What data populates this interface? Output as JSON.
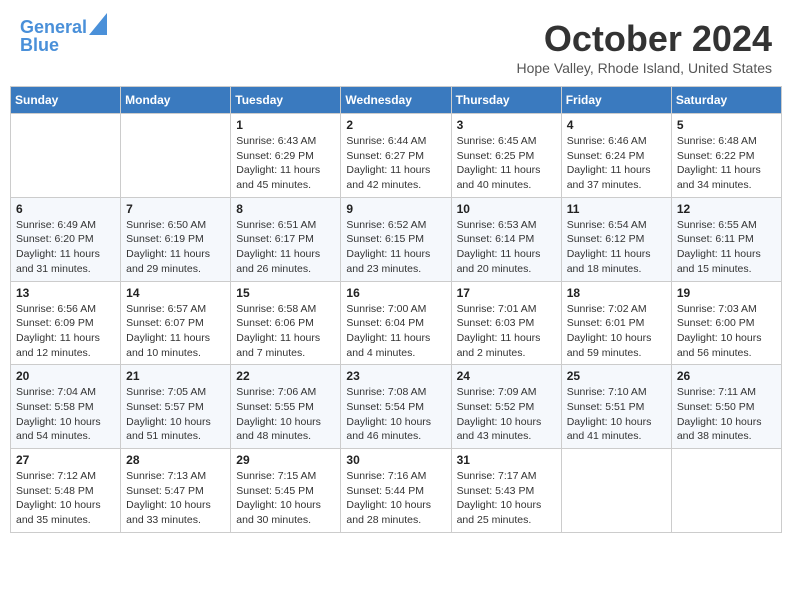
{
  "logo": {
    "line1": "General",
    "line2": "Blue"
  },
  "title": "October 2024",
  "subtitle": "Hope Valley, Rhode Island, United States",
  "weekdays": [
    "Sunday",
    "Monday",
    "Tuesday",
    "Wednesday",
    "Thursday",
    "Friday",
    "Saturday"
  ],
  "weeks": [
    [
      {
        "day": "",
        "sunrise": "",
        "sunset": "",
        "daylight": ""
      },
      {
        "day": "",
        "sunrise": "",
        "sunset": "",
        "daylight": ""
      },
      {
        "day": "1",
        "sunrise": "Sunrise: 6:43 AM",
        "sunset": "Sunset: 6:29 PM",
        "daylight": "Daylight: 11 hours and 45 minutes."
      },
      {
        "day": "2",
        "sunrise": "Sunrise: 6:44 AM",
        "sunset": "Sunset: 6:27 PM",
        "daylight": "Daylight: 11 hours and 42 minutes."
      },
      {
        "day": "3",
        "sunrise": "Sunrise: 6:45 AM",
        "sunset": "Sunset: 6:25 PM",
        "daylight": "Daylight: 11 hours and 40 minutes."
      },
      {
        "day": "4",
        "sunrise": "Sunrise: 6:46 AM",
        "sunset": "Sunset: 6:24 PM",
        "daylight": "Daylight: 11 hours and 37 minutes."
      },
      {
        "day": "5",
        "sunrise": "Sunrise: 6:48 AM",
        "sunset": "Sunset: 6:22 PM",
        "daylight": "Daylight: 11 hours and 34 minutes."
      }
    ],
    [
      {
        "day": "6",
        "sunrise": "Sunrise: 6:49 AM",
        "sunset": "Sunset: 6:20 PM",
        "daylight": "Daylight: 11 hours and 31 minutes."
      },
      {
        "day": "7",
        "sunrise": "Sunrise: 6:50 AM",
        "sunset": "Sunset: 6:19 PM",
        "daylight": "Daylight: 11 hours and 29 minutes."
      },
      {
        "day": "8",
        "sunrise": "Sunrise: 6:51 AM",
        "sunset": "Sunset: 6:17 PM",
        "daylight": "Daylight: 11 hours and 26 minutes."
      },
      {
        "day": "9",
        "sunrise": "Sunrise: 6:52 AM",
        "sunset": "Sunset: 6:15 PM",
        "daylight": "Daylight: 11 hours and 23 minutes."
      },
      {
        "day": "10",
        "sunrise": "Sunrise: 6:53 AM",
        "sunset": "Sunset: 6:14 PM",
        "daylight": "Daylight: 11 hours and 20 minutes."
      },
      {
        "day": "11",
        "sunrise": "Sunrise: 6:54 AM",
        "sunset": "Sunset: 6:12 PM",
        "daylight": "Daylight: 11 hours and 18 minutes."
      },
      {
        "day": "12",
        "sunrise": "Sunrise: 6:55 AM",
        "sunset": "Sunset: 6:11 PM",
        "daylight": "Daylight: 11 hours and 15 minutes."
      }
    ],
    [
      {
        "day": "13",
        "sunrise": "Sunrise: 6:56 AM",
        "sunset": "Sunset: 6:09 PM",
        "daylight": "Daylight: 11 hours and 12 minutes."
      },
      {
        "day": "14",
        "sunrise": "Sunrise: 6:57 AM",
        "sunset": "Sunset: 6:07 PM",
        "daylight": "Daylight: 11 hours and 10 minutes."
      },
      {
        "day": "15",
        "sunrise": "Sunrise: 6:58 AM",
        "sunset": "Sunset: 6:06 PM",
        "daylight": "Daylight: 11 hours and 7 minutes."
      },
      {
        "day": "16",
        "sunrise": "Sunrise: 7:00 AM",
        "sunset": "Sunset: 6:04 PM",
        "daylight": "Daylight: 11 hours and 4 minutes."
      },
      {
        "day": "17",
        "sunrise": "Sunrise: 7:01 AM",
        "sunset": "Sunset: 6:03 PM",
        "daylight": "Daylight: 11 hours and 2 minutes."
      },
      {
        "day": "18",
        "sunrise": "Sunrise: 7:02 AM",
        "sunset": "Sunset: 6:01 PM",
        "daylight": "Daylight: 10 hours and 59 minutes."
      },
      {
        "day": "19",
        "sunrise": "Sunrise: 7:03 AM",
        "sunset": "Sunset: 6:00 PM",
        "daylight": "Daylight: 10 hours and 56 minutes."
      }
    ],
    [
      {
        "day": "20",
        "sunrise": "Sunrise: 7:04 AM",
        "sunset": "Sunset: 5:58 PM",
        "daylight": "Daylight: 10 hours and 54 minutes."
      },
      {
        "day": "21",
        "sunrise": "Sunrise: 7:05 AM",
        "sunset": "Sunset: 5:57 PM",
        "daylight": "Daylight: 10 hours and 51 minutes."
      },
      {
        "day": "22",
        "sunrise": "Sunrise: 7:06 AM",
        "sunset": "Sunset: 5:55 PM",
        "daylight": "Daylight: 10 hours and 48 minutes."
      },
      {
        "day": "23",
        "sunrise": "Sunrise: 7:08 AM",
        "sunset": "Sunset: 5:54 PM",
        "daylight": "Daylight: 10 hours and 46 minutes."
      },
      {
        "day": "24",
        "sunrise": "Sunrise: 7:09 AM",
        "sunset": "Sunset: 5:52 PM",
        "daylight": "Daylight: 10 hours and 43 minutes."
      },
      {
        "day": "25",
        "sunrise": "Sunrise: 7:10 AM",
        "sunset": "Sunset: 5:51 PM",
        "daylight": "Daylight: 10 hours and 41 minutes."
      },
      {
        "day": "26",
        "sunrise": "Sunrise: 7:11 AM",
        "sunset": "Sunset: 5:50 PM",
        "daylight": "Daylight: 10 hours and 38 minutes."
      }
    ],
    [
      {
        "day": "27",
        "sunrise": "Sunrise: 7:12 AM",
        "sunset": "Sunset: 5:48 PM",
        "daylight": "Daylight: 10 hours and 35 minutes."
      },
      {
        "day": "28",
        "sunrise": "Sunrise: 7:13 AM",
        "sunset": "Sunset: 5:47 PM",
        "daylight": "Daylight: 10 hours and 33 minutes."
      },
      {
        "day": "29",
        "sunrise": "Sunrise: 7:15 AM",
        "sunset": "Sunset: 5:45 PM",
        "daylight": "Daylight: 10 hours and 30 minutes."
      },
      {
        "day": "30",
        "sunrise": "Sunrise: 7:16 AM",
        "sunset": "Sunset: 5:44 PM",
        "daylight": "Daylight: 10 hours and 28 minutes."
      },
      {
        "day": "31",
        "sunrise": "Sunrise: 7:17 AM",
        "sunset": "Sunset: 5:43 PM",
        "daylight": "Daylight: 10 hours and 25 minutes."
      },
      {
        "day": "",
        "sunrise": "",
        "sunset": "",
        "daylight": ""
      },
      {
        "day": "",
        "sunrise": "",
        "sunset": "",
        "daylight": ""
      }
    ]
  ]
}
